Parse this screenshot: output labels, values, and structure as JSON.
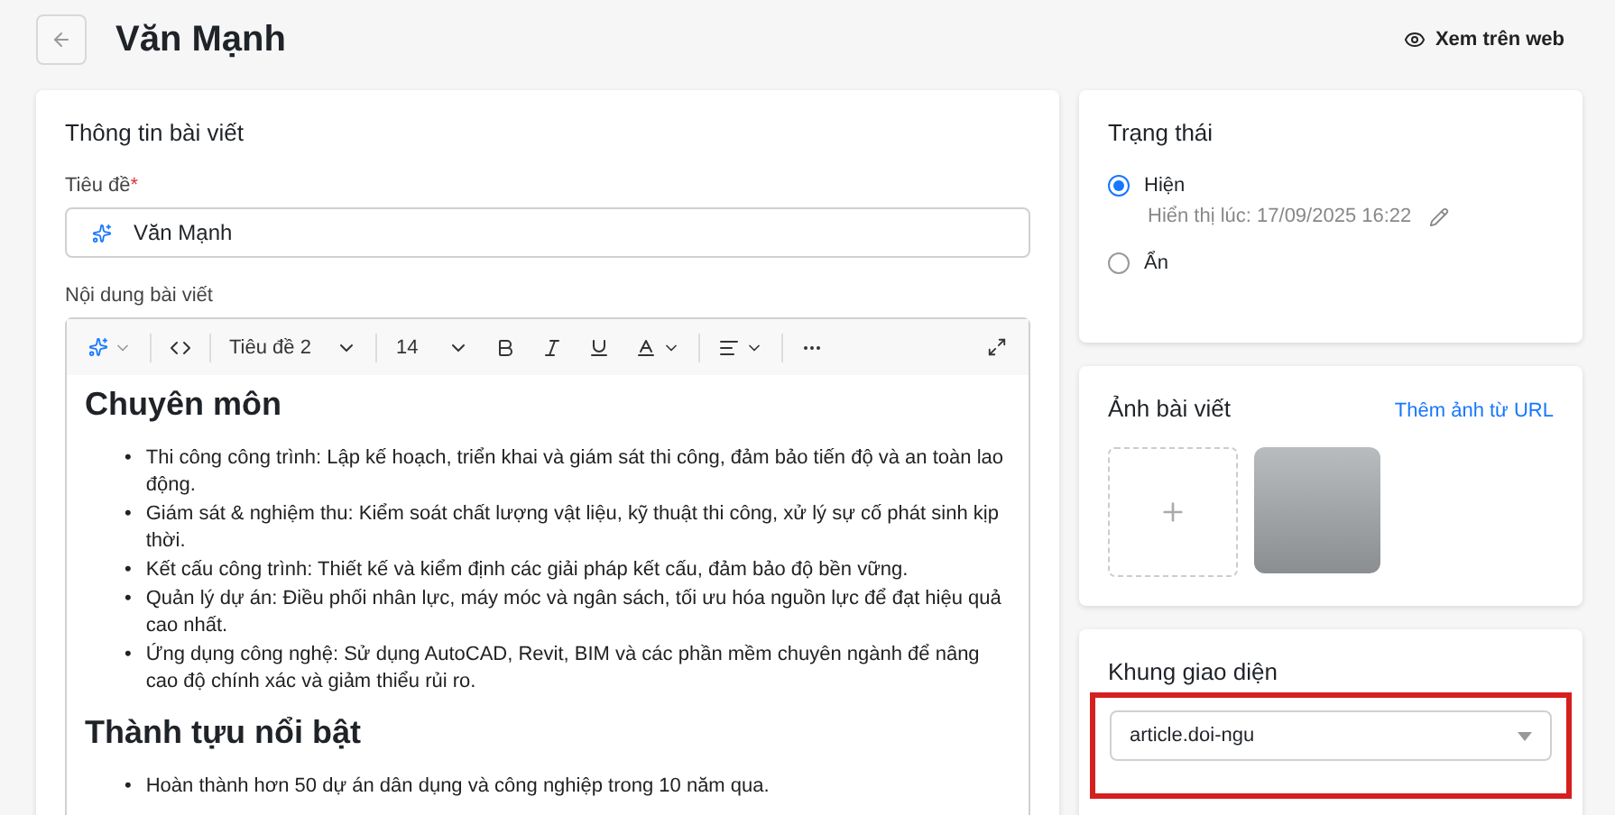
{
  "header": {
    "title": "Văn Mạnh",
    "view_link": "Xem trên web"
  },
  "article": {
    "card_title": "Thông tin bài viết",
    "title_label": "Tiêu đề",
    "required_mark": "*",
    "title_value": "Văn Mạnh",
    "content_label": "Nội dung bài viết",
    "toolbar": {
      "heading_style": "Tiêu đề 2",
      "font_size": "14"
    },
    "content": [
      {
        "kind": "heading",
        "text": "Chuyên môn"
      },
      {
        "kind": "list",
        "marker": "•",
        "items": [
          "Thi công công trình: Lập kế hoạch, triển khai và giám sát thi công, đảm bảo tiến độ và an toàn lao động.",
          "Giám sát & nghiệm thu: Kiểm soát chất lượng vật liệu, kỹ thuật thi công, xử lý sự cố phát sinh kịp thời.",
          "Kết cấu công trình: Thiết kế và kiểm định các giải pháp kết cấu, đảm bảo độ bền vững.",
          "Quản lý dự án: Điều phối nhân lực, máy móc và ngân sách, tối ưu hóa nguồn lực để đạt hiệu quả cao nhất.",
          "Ứng dụng công nghệ: Sử dụng AutoCAD, Revit, BIM và các phần mềm chuyên ngành để nâng cao độ chính xác và giảm thiểu rủi ro."
        ]
      },
      {
        "kind": "heading",
        "text": "Thành tựu nổi bật"
      },
      {
        "kind": "list",
        "marker": "•",
        "items": [
          "Hoàn thành hơn 50 dự án dân dụng và công nghiệp trong 10 năm qua."
        ]
      }
    ]
  },
  "status": {
    "card_title": "Trạng thái",
    "options": [
      {
        "label": "Hiện",
        "selected": true,
        "note": "Hiển thị lúc: 17/09/2025 16:22"
      },
      {
        "label": "Ẩn",
        "selected": false
      }
    ]
  },
  "image": {
    "card_title": "Ảnh bài viết",
    "url_link": "Thêm ảnh từ URL"
  },
  "layout": {
    "card_title": "Khung giao diện",
    "value": "article.doi-ngu",
    "highlighted": true
  }
}
